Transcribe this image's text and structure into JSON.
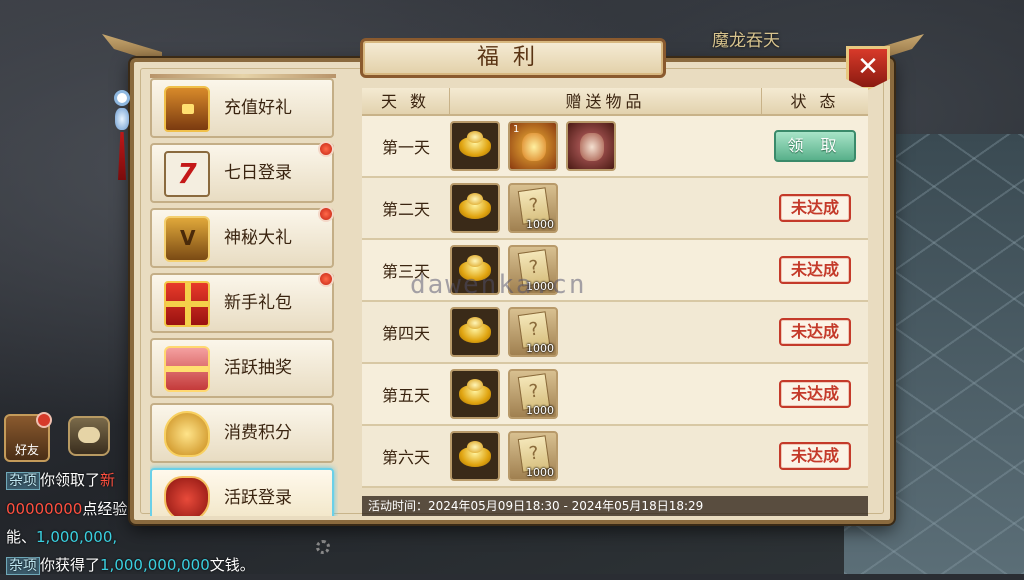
{
  "scene": {
    "location_label": "魔龙吞天"
  },
  "window": {
    "title": "福利",
    "close_glyph": "✕"
  },
  "sidebar": {
    "items": [
      {
        "label": "充值好礼",
        "icon": "treasure-chest-icon",
        "red_dot": false,
        "active": false
      },
      {
        "label": "七日登录",
        "icon": "calendar-icon",
        "icon_text": "7",
        "red_dot": true,
        "active": false
      },
      {
        "label": "神秘大礼",
        "icon": "mystery-chest-icon",
        "red_dot": true,
        "active": false
      },
      {
        "label": "新手礼包",
        "icon": "gift-box-icon",
        "red_dot": true,
        "active": false
      },
      {
        "label": "活跃抽奖",
        "icon": "lottery-box-icon",
        "red_dot": false,
        "active": false
      },
      {
        "label": "消费积分",
        "icon": "gold-coins-icon",
        "red_dot": false,
        "active": false
      },
      {
        "label": "活跃登录",
        "icon": "lucky-bag-icon",
        "red_dot": false,
        "active": true
      }
    ]
  },
  "table": {
    "headers": {
      "day": "天 数",
      "items": "赠送物品",
      "status": "状 态"
    },
    "rows": [
      {
        "day": "第一天",
        "items": [
          {
            "type": "gold-ingot"
          },
          {
            "type": "pet-golden-dragon",
            "level": "1"
          },
          {
            "type": "pet-red-beast"
          }
        ],
        "status": "领 取",
        "claimable": true
      },
      {
        "day": "第二天",
        "items": [
          {
            "type": "gold-ingot"
          },
          {
            "type": "mystery-card",
            "qty": "1000"
          }
        ],
        "status": "未达成",
        "claimable": false
      },
      {
        "day": "第三天",
        "items": [
          {
            "type": "gold-ingot"
          },
          {
            "type": "mystery-card",
            "qty": "1000"
          }
        ],
        "status": "未达成",
        "claimable": false
      },
      {
        "day": "第四天",
        "items": [
          {
            "type": "gold-ingot"
          },
          {
            "type": "mystery-card",
            "qty": "1000"
          }
        ],
        "status": "未达成",
        "claimable": false
      },
      {
        "day": "第五天",
        "items": [
          {
            "type": "gold-ingot"
          },
          {
            "type": "mystery-card",
            "qty": "1000"
          }
        ],
        "status": "未达成",
        "claimable": false
      },
      {
        "day": "第六天",
        "items": [
          {
            "type": "gold-ingot"
          },
          {
            "type": "mystery-card",
            "qty": "1000"
          }
        ],
        "status": "未达成",
        "claimable": false
      }
    ]
  },
  "activity_time": "活动时间：2024年05月09日18:30 - 2024年05月18日18:29",
  "watermark": "dawenka.cn",
  "hud": {
    "friend_label": "好友"
  },
  "chat": {
    "lines": [
      {
        "tag": "杂项",
        "text": "你领取了",
        "highlight": "新"
      },
      {
        "text_red": "00000000",
        "text": "点经验"
      },
      {
        "text": "能、",
        "text_cyan": "1,000,000,"
      },
      {
        "tag": "杂项",
        "text": "你获得了",
        "text_cyan": "1,000,000,000",
        "text_end": "文钱。"
      }
    ]
  },
  "colors": {
    "panel_bg": "#e9dcc0",
    "frame_brown": "#8a6a3e",
    "claim_green": "#58b08a",
    "stamp_red": "#c43a2a",
    "red_dot": "#c42212"
  }
}
